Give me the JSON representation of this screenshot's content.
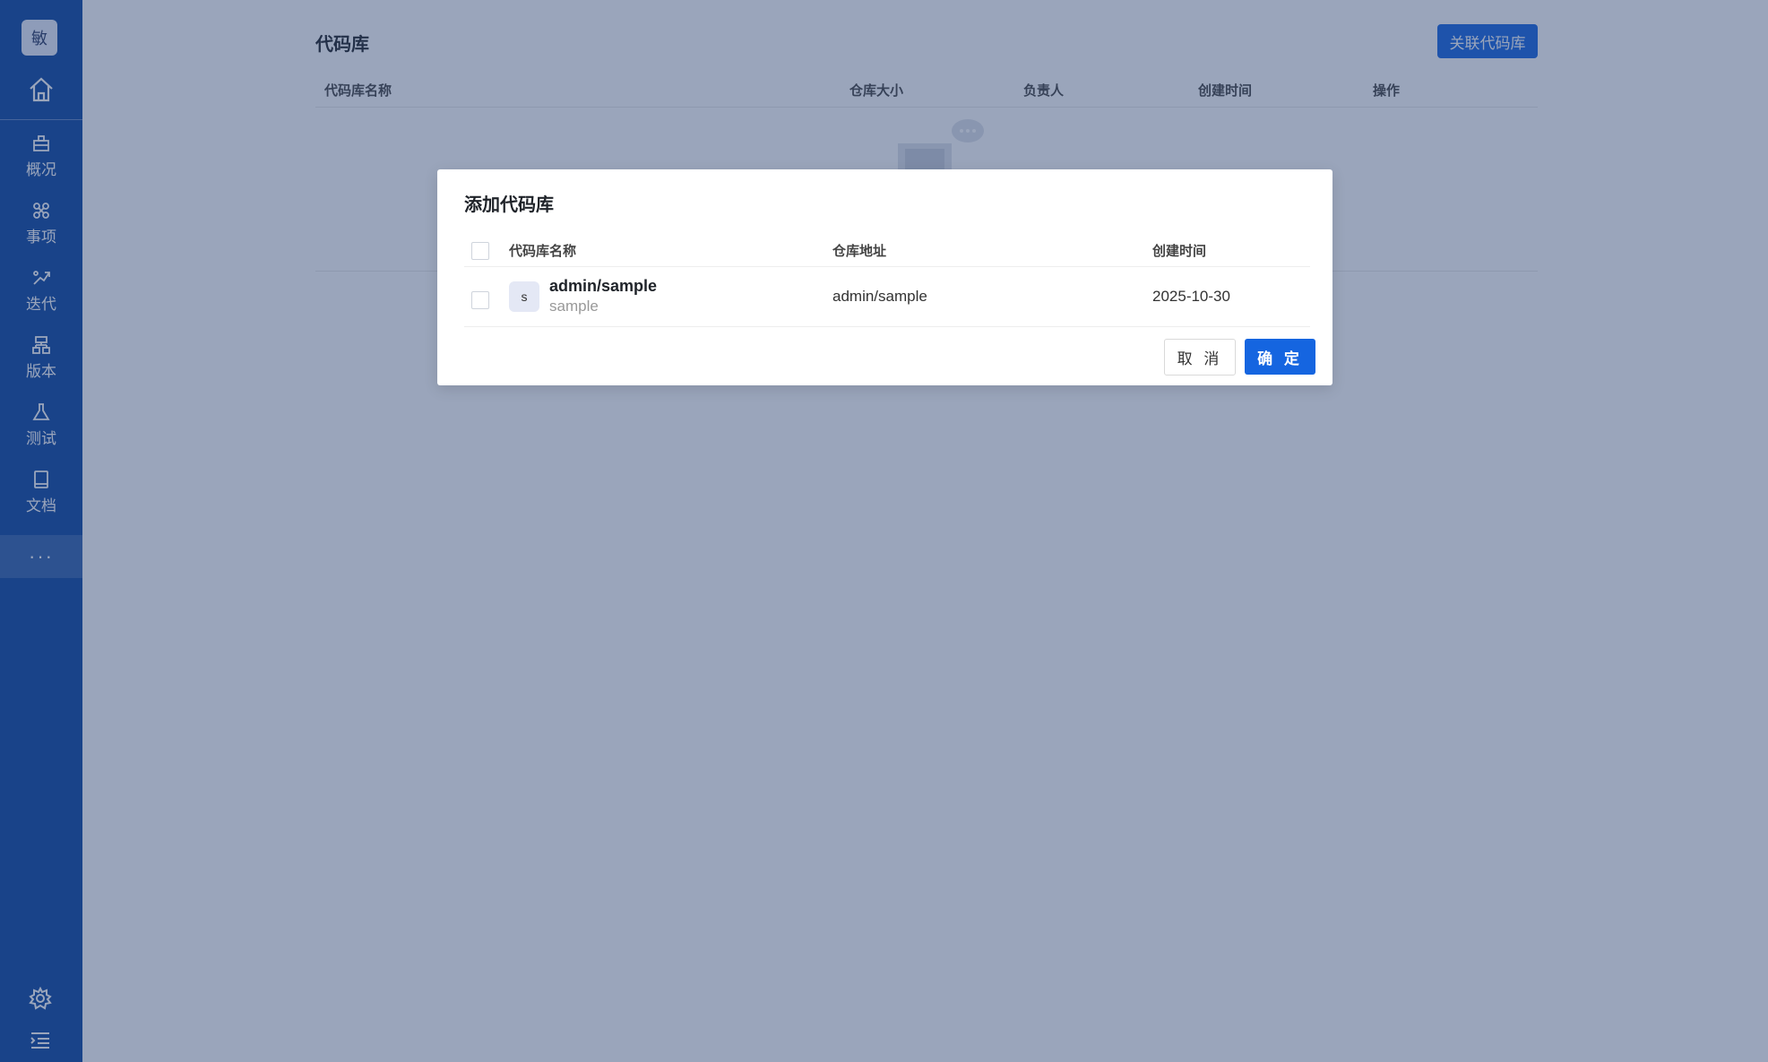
{
  "sidebar": {
    "logo_text": "敏",
    "items": [
      {
        "label": "概况",
        "icon": "overview-icon"
      },
      {
        "label": "事项",
        "icon": "workitem-icon"
      },
      {
        "label": "迭代",
        "icon": "sprint-icon"
      },
      {
        "label": "版本",
        "icon": "version-icon"
      },
      {
        "label": "测试",
        "icon": "test-flask-icon"
      },
      {
        "label": "文档",
        "icon": "book-icon"
      }
    ],
    "more_label": "···"
  },
  "page": {
    "title": "代码库",
    "link_button": "关联代码库",
    "columns": [
      "代码库名称",
      "仓库大小",
      "负责人",
      "创建时间",
      "操作"
    ]
  },
  "modal": {
    "title": "添加代码库",
    "columns": [
      "代码库名称",
      "仓库地址",
      "创建时间"
    ],
    "rows": [
      {
        "avatar": "s",
        "name": "admin/sample",
        "sub": "sample",
        "address": "admin/sample",
        "created": "2025-10-30"
      }
    ],
    "cancel_label": "取 消",
    "ok_label": "确 定"
  },
  "colors": {
    "accent": "#1565e0",
    "sidebar": "#0d47a1"
  }
}
